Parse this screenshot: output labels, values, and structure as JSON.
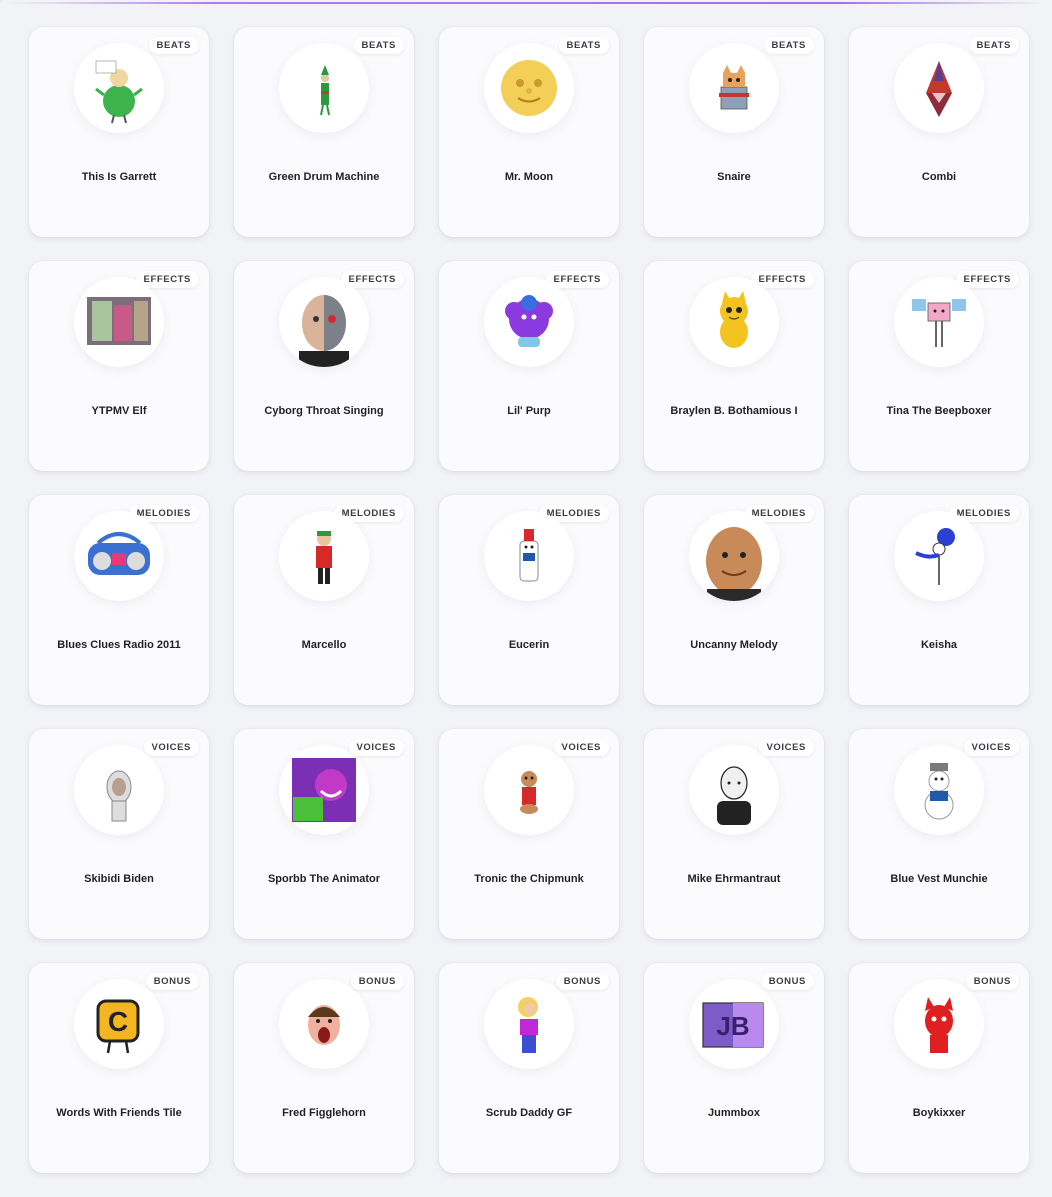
{
  "cards": [
    {
      "name": "This Is Garrett",
      "category": "BEATS",
      "icon": "green-man-icon"
    },
    {
      "name": "Green Drum Machine",
      "category": "BEATS",
      "icon": "elf-figure-icon"
    },
    {
      "name": "Mr. Moon",
      "category": "BEATS",
      "icon": "moon-face-icon"
    },
    {
      "name": "Snaire",
      "category": "BEATS",
      "icon": "robot-cat-icon"
    },
    {
      "name": "Combi",
      "category": "BEATS",
      "icon": "geometric-figure-icon"
    },
    {
      "name": "YTPMV Elf",
      "category": "EFFECTS",
      "icon": "photo-elf-icon"
    },
    {
      "name": "Cyborg Throat Singing",
      "category": "EFFECTS",
      "icon": "cyborg-face-icon"
    },
    {
      "name": "Lil' Purp",
      "category": "EFFECTS",
      "icon": "purple-creature-icon"
    },
    {
      "name": "Braylen B. Bothamious I",
      "category": "EFFECTS",
      "icon": "yellow-cat-icon"
    },
    {
      "name": "Tina The Beepboxer",
      "category": "EFFECTS",
      "icon": "pink-box-icon"
    },
    {
      "name": "Blues Clues Radio 2011",
      "category": "MELODIES",
      "icon": "radio-icon"
    },
    {
      "name": "Marcello",
      "category": "MELODIES",
      "icon": "red-jacket-figure-icon"
    },
    {
      "name": "Eucerin",
      "category": "MELODIES",
      "icon": "lotion-bottle-icon"
    },
    {
      "name": "Uncanny Melody",
      "category": "MELODIES",
      "icon": "uncanny-face-icon"
    },
    {
      "name": "Keisha",
      "category": "MELODIES",
      "icon": "blue-hair-figure-icon"
    },
    {
      "name": "Skibidi Biden",
      "category": "VOICES",
      "icon": "toilet-face-icon"
    },
    {
      "name": "Sporbb The Animator",
      "category": "VOICES",
      "icon": "purple-cartoon-icon"
    },
    {
      "name": "Tronic the Chipmunk",
      "category": "VOICES",
      "icon": "chipmunk-icon"
    },
    {
      "name": "Mike Ehrmantraut",
      "category": "VOICES",
      "icon": "bald-man-icon"
    },
    {
      "name": "Blue Vest Munchie",
      "category": "VOICES",
      "icon": "snowman-icon"
    },
    {
      "name": "Words With Friends Tile",
      "category": "BONUS",
      "icon": "letter-tile-icon",
      "glyph": "C"
    },
    {
      "name": "Fred Figglehorn",
      "category": "BONUS",
      "icon": "screaming-boy-icon"
    },
    {
      "name": "Scrub Daddy GF",
      "category": "BONUS",
      "icon": "blonde-figure-icon"
    },
    {
      "name": "Jummbox",
      "category": "BONUS",
      "icon": "jb-logo-icon",
      "glyph": "JB"
    },
    {
      "name": "Boykixxer",
      "category": "BONUS",
      "icon": "red-creature-icon"
    }
  ]
}
